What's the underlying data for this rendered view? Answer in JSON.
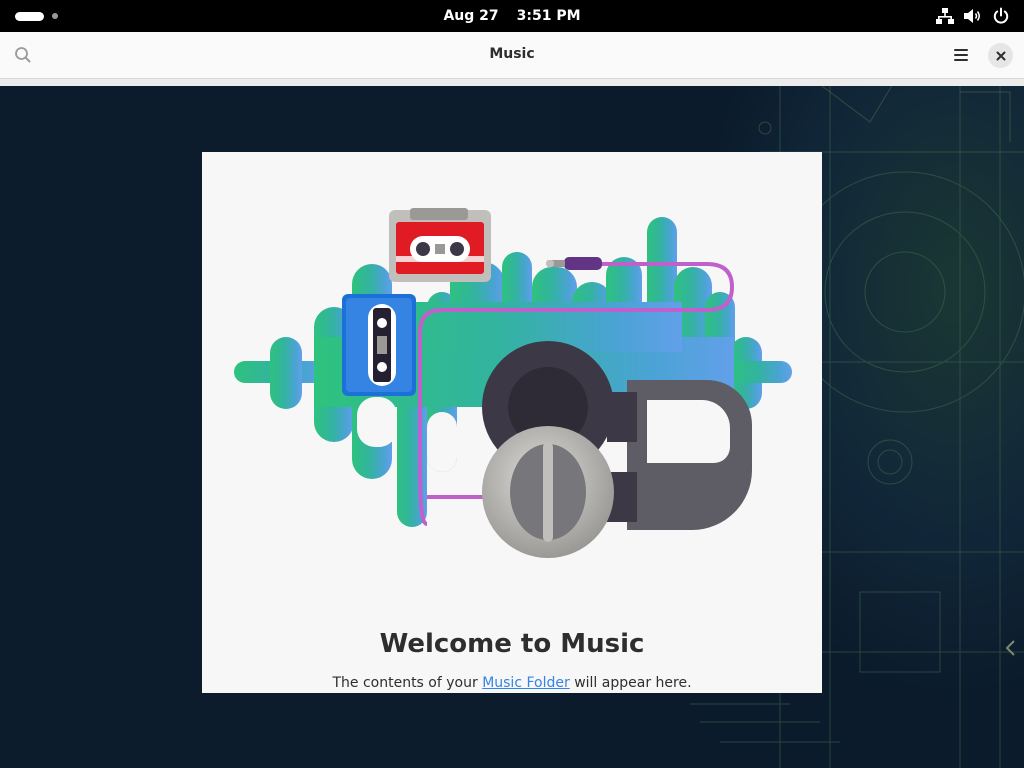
{
  "topbar": {
    "date": "Aug 27",
    "time": "3:51 PM",
    "icons": [
      "network-wired-icon",
      "volume-icon",
      "power-icon"
    ]
  },
  "app": {
    "title": "Music",
    "buttons": [
      "search-icon",
      "menu-icon",
      "close-icon"
    ]
  },
  "welcome": {
    "title": "Welcome to Music",
    "text_before": "The contents of your ",
    "link": "Music Folder",
    "text_after": " will appear here."
  },
  "colors": {
    "topbar": "#000000",
    "headerbar": "#fafafa",
    "card": "#f7f7f7",
    "link": "#3584e4",
    "wallpaper": "#0c1c2c"
  }
}
